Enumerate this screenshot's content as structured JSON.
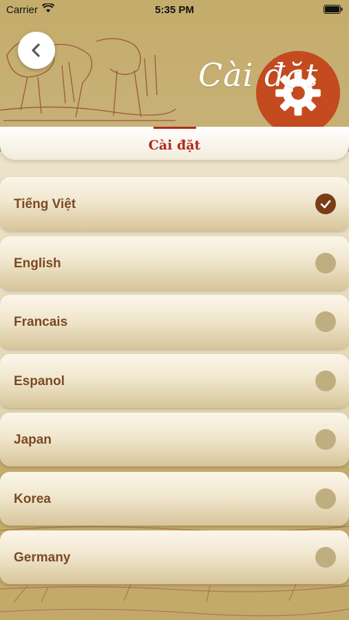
{
  "status_bar": {
    "carrier": "Carrier",
    "time": "5:35 PM"
  },
  "header": {
    "title": "Cài đặt",
    "back_icon": "chevron-left-icon",
    "badge_icon": "gear-icon"
  },
  "tabs": {
    "active_label": "Cài đặt"
  },
  "languages": [
    {
      "label": "Tiếng Việt",
      "selected": true
    },
    {
      "label": "English",
      "selected": false
    },
    {
      "label": "Francais",
      "selected": false
    },
    {
      "label": "Espanol",
      "selected": false
    },
    {
      "label": "Japan",
      "selected": false
    },
    {
      "label": "Korea",
      "selected": false
    },
    {
      "label": "Germany",
      "selected": false
    }
  ],
  "colors": {
    "accent_red": "#b3281e",
    "badge_orange": "#c44a1f",
    "header_gold": "#c4ac6b",
    "label_brown": "#7a4a22",
    "check_brown": "#7a3e17",
    "radio_idle": "#bfae80"
  }
}
